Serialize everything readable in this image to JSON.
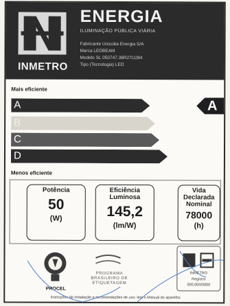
{
  "header": {
    "logo_text": "INMETRO",
    "title": "ENERGIA",
    "subtitle": "ILUMINAÇÃO PÚBLICA VIÁRIA",
    "info_lines": [
      "Fabricante Unicoba Energia S/A",
      "Marca LEDBEAM",
      "Modelo SL 050747.38R27U284",
      "Tipo (Tecnologia) LED"
    ]
  },
  "efficiency": {
    "top_label": "Mais eficiente",
    "bottom_label": "Menos eficiente",
    "classes": [
      "A",
      "B",
      "C",
      "D"
    ],
    "rating": "A"
  },
  "specs": [
    {
      "name": "Potência",
      "value": "50",
      "unit": "(W)"
    },
    {
      "name": "Eficiência Luminosa",
      "value": "145,2",
      "unit": "(lm/W)"
    },
    {
      "name": "Vida Declarada Nominal",
      "value": "78000",
      "unit": "(h)"
    }
  ],
  "seals": {
    "procel": "PROCEL",
    "pbe_lines": [
      "PROGRAMA",
      "BRASILEIRO DE",
      "ETIQUETAGEM"
    ],
    "inmetro_lines": [
      "INMETRO",
      "Registro",
      "000.000/0000"
    ]
  },
  "footnote": "Instruções de instalação e recomendações de uso: leia o Manual do aparelho",
  "colors": {
    "header": "#2b2b2b",
    "bar": "#2c2c2c",
    "bar_faded": "#d8d5cd",
    "scribble": "#4d7ec7"
  }
}
